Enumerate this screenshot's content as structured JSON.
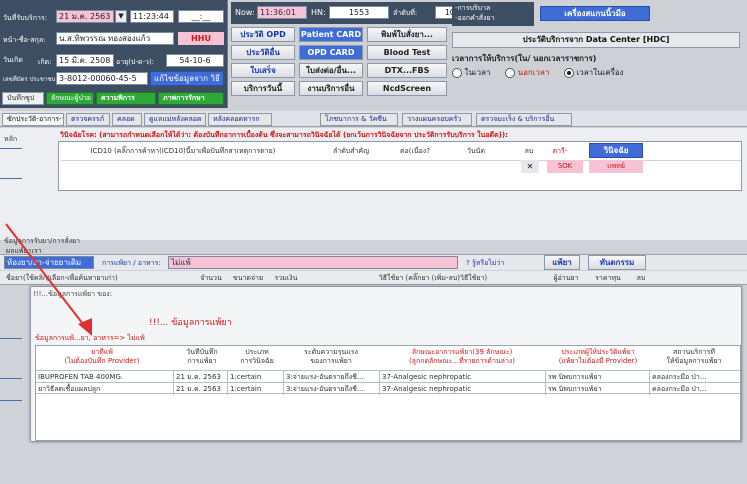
{
  "top": {
    "visit_date_label": "วันที่รับบริการ:",
    "visit_date_value": "21 ม.ค. 2563",
    "visit_time_value": "11:23:44",
    "time_mask": "__:__",
    "name_label": "หน้า-ชื่อ-สกุล:",
    "name_value": "น.ส.ทิพวรรณ ทองสองแก้ว",
    "badge_text": "HHU",
    "dob_label": "วันเกิด",
    "dob_field_label": "เกิด:",
    "dob_value": "15 มี.ค. 2508",
    "age_label": "อายุ(ป-ด-ว):",
    "age_value": "54-10-6",
    "cid_label": "เลขที่บัตร ประชาชน:",
    "cid_value": "3-8012-00060-45-5",
    "verify_label": "แก้ไขข้อมูลจาก วิธี",
    "save_tab": "บันทึกซูป",
    "diag_tab": "ลักษณะผู้ป่วย",
    "exam_tab": "ความพิการ",
    "refer_tab": "ภาพการรักษา",
    "now_label": "Now:",
    "now_value": "11:36:01",
    "hn_label": "HN:",
    "hn_value": "1553",
    "seq_label": "ลำดับที่:",
    "seq_value": "104453",
    "service_label": "-การบริบาล\n-ออกคำสั่งยา",
    "scanner_btn": "เครื่องสแกนนิ้วมือ"
  },
  "buttons": {
    "b1": "ประวัติ OPD",
    "b2": "Patient CARD",
    "b3": "พิมพ์ใบสั่งยา...",
    "b4": "ประวัติอื่น",
    "b5": "OPD CARD",
    "b6": "Blood Test",
    "b7": "ใบเสร็จ",
    "b8": "ใบส่งต่อ/อื่น...",
    "b9": "DTX...FBS",
    "b10": "บริการวันนี้",
    "b11": "งานบริการอื่น",
    "b12": "NcdScreen"
  },
  "hdc": {
    "title": "ประวัติบริการจาก Data Center [HDC]",
    "time_title": "เวลาการให้บริการ(ใน/ นอกเวลาราชการ)",
    "opt1": "ในเวลา",
    "opt2": "นอกเวลา",
    "opt3": "เวลาในเครื่อง"
  },
  "tabs": [
    {
      "label": "ซักประวัติ-อาการ-วางแผน"
    },
    {
      "label": "ตรวจครรภ์"
    },
    {
      "label": "คลอด"
    },
    {
      "label": "ดูแลแม่หลังคลอด"
    },
    {
      "label": "หลังคลอดทารก"
    },
    {
      "label": "โภชนาการ & วัคซีน"
    },
    {
      "label": "วางแผนครอบครัว"
    },
    {
      "label": "ตรวจมะเร็ง & บริการอื่น"
    }
  ],
  "diag": {
    "notice": "วินิจฉัยโรค: (สามารถกำหนดเลือกให้ได้ว่า: ต้องบันทึกอาการเบื้องต้น ซึ่งจะสามารถวินิจฉัยได้ (ยกเว้นการวินิจฉัยจาก ประวัติการรับบริการ ในอดีต)):",
    "left_label": "หลัก",
    "col_icd": "ICD10 (คลิ๊กการค้าหา(ICD10)นี้มาเพื่อบันทึกสาเหตุการตาย)",
    "col_rank": "ลำดับสำคัญ",
    "col_continue": "ต่อ(เนื่อง?",
    "col_date": "วันนัด",
    "col_del": "ลบ",
    "col_red": "ตารี-",
    "col_diag": "วินิจฉัย",
    "row_x": "✕",
    "row_sok": "SOK",
    "row_pink": "แพทย์"
  },
  "drugs": {
    "section_label": "ข้อมูลการรับยา/การสั่งยา",
    "owner_label": "ผลแพ้ยาเรา",
    "input_label": "ห้องยา/ยา-จ่ายยาเดิม",
    "search_label": "การแพ้ยา / อาหาร:",
    "search_value": "ไม่แพ้",
    "hint": "? รู้หรือไม่ว่า",
    "allergy_btn": "แพ้ยา",
    "med_btn": "ทันตกรรม",
    "cols": [
      "ชื่อยา(ใช้คลิก/เลือก-เพื่อค้นหายาเก่า)",
      "จำนวน",
      "ขนาดจ่าย",
      "รวมเงิน",
      "วิธีใช้ยา (คลิ๊กยา (เพิ่ม-ลบ)วิธีใช้ยา)",
      "ผู้อ่านยา",
      "ราคาทุน",
      "ลบ"
    ]
  },
  "popup": {
    "small_title": "!!!...ข้อมูลการแพ้ยา ของ:",
    "title": "!!!... ข้อมูลการแพ้ยา",
    "food_label": "ข้อมูลการแพ้...ยา, อาหาร=> ไม่แพ้",
    "headers": [
      "ยาที่แพ้\n(ไม่ต้องบันทึก Provider)",
      "วันที่บันทึก\nการแพ้ยา",
      "ประเภท\nการวินิจฉัย",
      "ระดับความรุนแรง\nของการแพ้ยา",
      "ลักษณะอาการแพ้ยา(39 ลักษณะ)\n(ลูกกดลักษณะ...ที่รายการด้านล่าง)",
      "ประเภทผู้ให้ประวัติแพ้ยา\n(แพ้ยาไม่ต้องมี Provider)",
      "สถานบริการที่\nให้ข้อมูลการแพ้ยา"
    ],
    "rows": [
      [
        "IBUPROFEN TAB 400MG.",
        "21 ม.ค. 2563",
        "1:certain",
        "3:จ่ายแรง-อันตรายถึงชี...",
        "37-Analgesic nephropatic",
        "รพ นิพบการแพ้ยา",
        "คลองกระมือ ป่า..."
      ],
      [
        "ยาวิธีลดเชื้อแผลปลูก",
        "21 ม.ค. 2563",
        "1:certain",
        "3:จ่ายแรง-อันตรายถึงชี...",
        "37-Analgesic nephropatic",
        "รพ นิพบการแพ้ยา",
        "คลองกระมือ ป่า..."
      ]
    ]
  },
  "colors": {
    "accent_blue": "#1c3bb0",
    "pink_input": "#f6c2d6",
    "red_text": "#d01818",
    "green_tab": "#2fa83a",
    "arrow_red": "#e23030"
  }
}
